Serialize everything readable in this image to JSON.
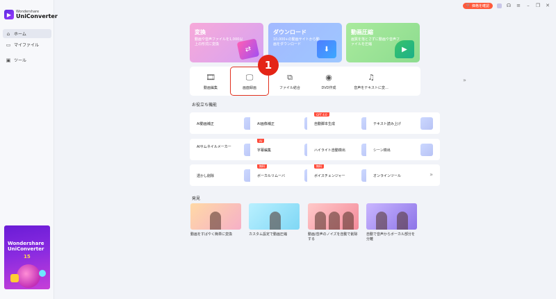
{
  "app": {
    "brand": "Wondershare",
    "product": "UniConverter"
  },
  "sidebar": {
    "items": [
      {
        "label": "ホーム",
        "icon": "home-icon",
        "active": true
      },
      {
        "label": "マイファイル",
        "icon": "folder-icon",
        "active": false
      },
      {
        "label": "ツール",
        "icon": "toolbox-icon",
        "active": false
      }
    ],
    "promo": {
      "line1": "Wondershare",
      "line2": "UniConverter",
      "line3": "15"
    }
  },
  "titlebar": {
    "price_button": "価格を確認"
  },
  "feature_cards": [
    {
      "title": "変換",
      "desc": "動画や音声ファイルを1,000以上の形式に変換"
    },
    {
      "title": "ダウンロード",
      "desc": "10,000+の動画サイトから動画をダウンロード"
    },
    {
      "title": "動画圧縮",
      "desc": "画質を落とさずに動画や音声ファイルを圧縮"
    }
  ],
  "tools": [
    {
      "label": "動画編集",
      "icon": "film-icon"
    },
    {
      "label": "画面録画",
      "icon": "screen-record-icon"
    },
    {
      "label": "ファイル結合",
      "icon": "merge-icon"
    },
    {
      "label": "DVD作成",
      "icon": "disc-icon"
    },
    {
      "label": "音声をテキストに変...",
      "icon": "speech-to-text-icon"
    }
  ],
  "callout_number": "1",
  "useful_section_title": "お役立ち機能",
  "useful_tools": [
    {
      "label": "AI動画補正",
      "badge": ""
    },
    {
      "label": "AI画像補正",
      "badge": ""
    },
    {
      "label": "自動脚本生成",
      "badge": "GPT 4.0"
    },
    {
      "label": "テキスト読み上げ",
      "badge": ""
    },
    {
      "label": "AIサムネイルメーカー",
      "badge": ""
    },
    {
      "label": "字幕編集",
      "badge": "AI"
    },
    {
      "label": "ハイライト自動検出",
      "badge": ""
    },
    {
      "label": "シーン検出",
      "badge": ""
    },
    {
      "label": "透かし削除",
      "badge": ""
    },
    {
      "label": "ボーカルリムーバ",
      "badge": "無料"
    },
    {
      "label": "ボイスチェンジャー",
      "badge": "無料"
    },
    {
      "label": "オンラインツール",
      "badge": ""
    }
  ],
  "discover_section_title": "発見",
  "discover": [
    {
      "title": "動画をすばやく簡単に変換"
    },
    {
      "title": "カスタム設定で動画圧縮"
    },
    {
      "title": "動画/音声のノイズを自動で削除する"
    },
    {
      "title": "自動で音声からボーカル部分を分離"
    }
  ],
  "colors": {
    "accent_red": "#e42416",
    "price_button": "#ff5a3c",
    "badge_red": "#ff4d3c"
  }
}
